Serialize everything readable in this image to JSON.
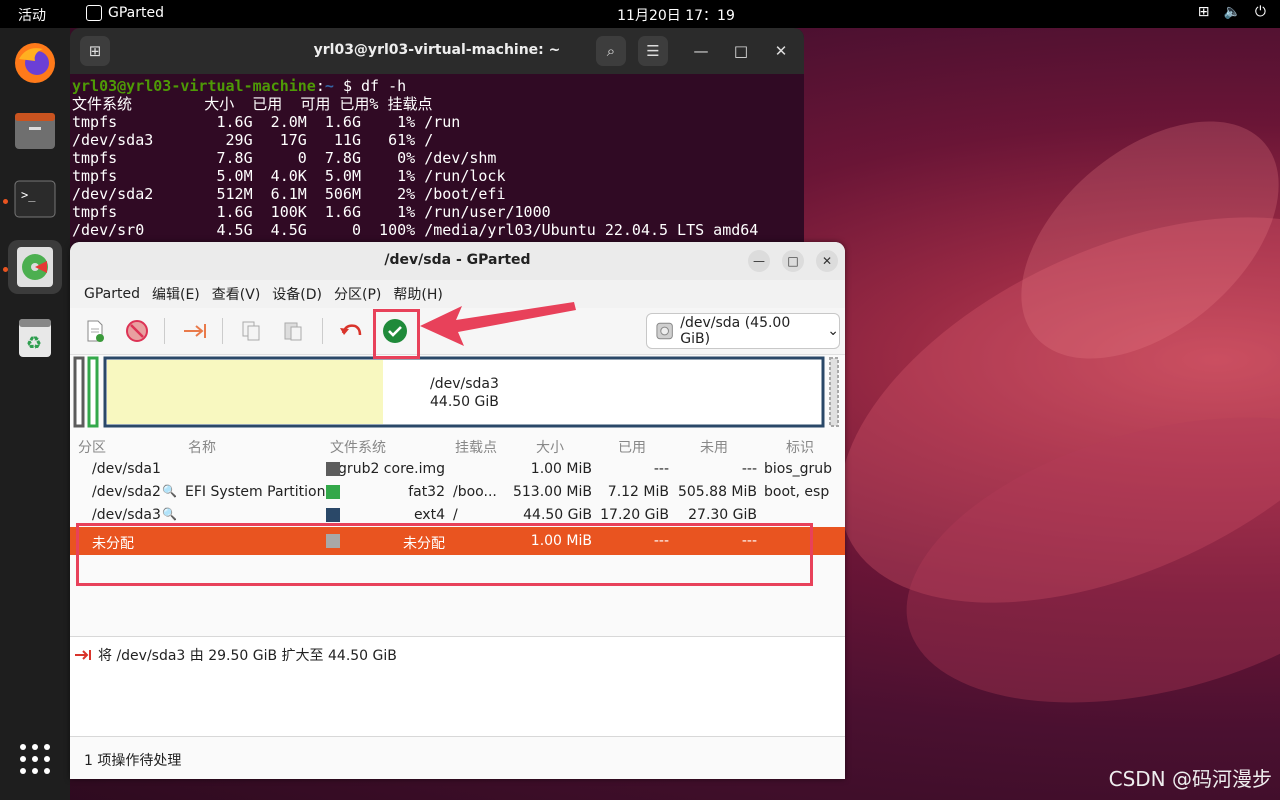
{
  "topbar": {
    "activities": "活动",
    "app_name": "GParted",
    "clock": "11月20日  17：19"
  },
  "terminal": {
    "title": "yrl03@yrl03-virtual-machine: ~",
    "prompt_user": "yrl03@yrl03-virtual-machine",
    "prompt_sep": ":",
    "prompt_path": "~",
    "prompt_cmd": "$ df -h",
    "lines": [
      "文件系统        大小  已用  可用 已用% 挂载点",
      "tmpfs           1.6G  2.0M  1.6G    1% /run",
      "/dev/sda3        29G   17G   11G   61% /",
      "tmpfs           7.8G     0  7.8G    0% /dev/shm",
      "tmpfs           5.0M  4.0K  5.0M    1% /run/lock",
      "/dev/sda2       512M  6.1M  506M    2% /boot/efi",
      "tmpfs           1.6G  100K  1.6G    1% /run/user/1000",
      "/dev/sr0        4.5G  4.5G     0  100% /media/yrl03/Ubuntu 22.04.5 LTS amd64"
    ]
  },
  "gparted": {
    "title": "/dev/sda - GParted",
    "menu": [
      "GParted",
      "编辑(E)",
      "查看(V)",
      "设备(D)",
      "分区(P)",
      "帮助(H)"
    ],
    "device_selector": "/dev/sda (45.00 GiB)",
    "map_label_name": "/dev/sda3",
    "map_label_size": "44.50 GiB",
    "map_used_fraction": 0.387,
    "columns": [
      "分区",
      "名称",
      "文件系统",
      "挂载点",
      "大小",
      "已用",
      "未用",
      "标识"
    ],
    "rows": [
      {
        "partition": "/dev/sda1",
        "name": "",
        "fs": "grub2 core.img",
        "mount": "",
        "size": "1.00 MiB",
        "used": "---",
        "unused": "---",
        "flags": "bios_grub",
        "color": "#5c5c5c"
      },
      {
        "partition": "/dev/sda2",
        "name": "EFI System Partition",
        "fs": "fat32",
        "mount": "/boo...",
        "size": "513.00 MiB",
        "used": "7.12 MiB",
        "unused": "505.88 MiB",
        "flags": "boot, esp",
        "color": "#33a84a"
      },
      {
        "partition": "/dev/sda3",
        "name": "",
        "fs": "ext4",
        "mount": "/",
        "size": "44.50 GiB",
        "used": "17.20 GiB",
        "unused": "27.30 GiB",
        "flags": "",
        "color": "#2a4868"
      },
      {
        "partition": "未分配",
        "name": "",
        "fs": "未分配",
        "mount": "",
        "size": "1.00 MiB",
        "used": "---",
        "unused": "---",
        "flags": "",
        "color": "#a8a8a8"
      }
    ],
    "pending_operation": "将 /dev/sda3 由 29.50 GiB 扩大至 44.50 GiB",
    "status": "1 项操作待处理"
  },
  "colors": {
    "selection": "#e95420",
    "annotation": "#e8415a"
  },
  "watermark": "CSDN @码河漫步"
}
